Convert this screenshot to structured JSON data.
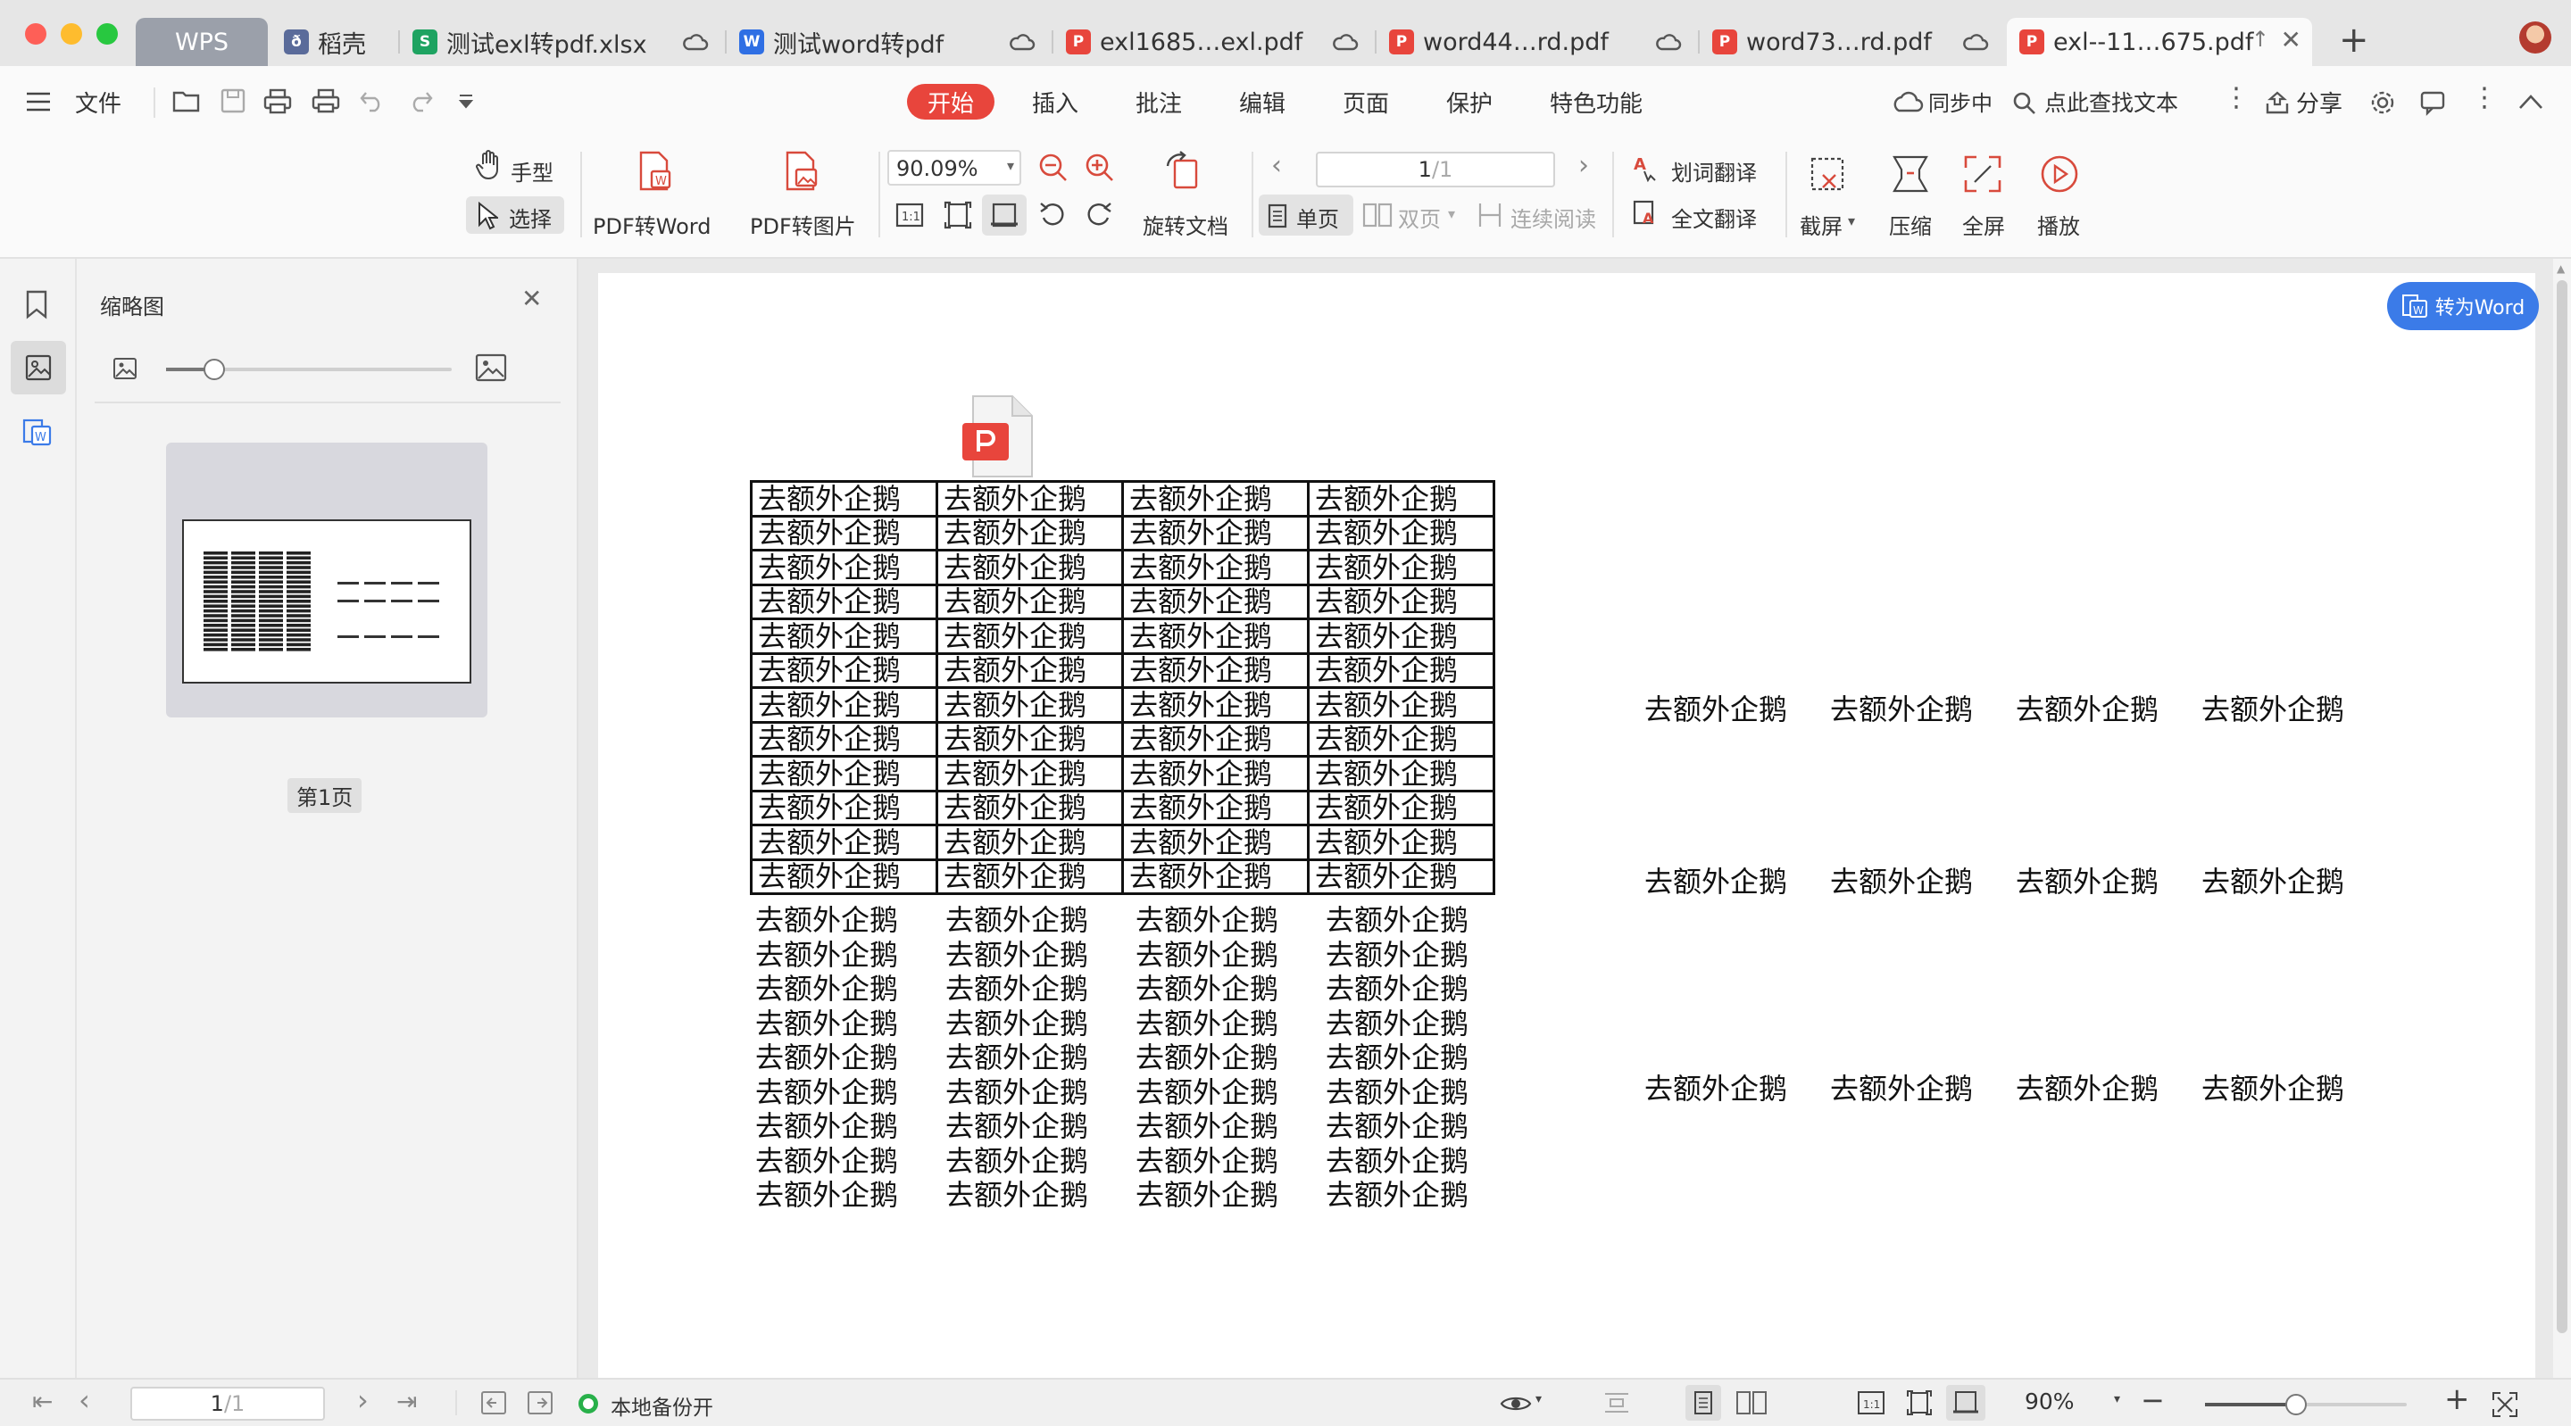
{
  "tabs": {
    "wps": "WPS",
    "items": [
      {
        "label": "稻壳"
      },
      {
        "label": "测试exl转pdf.xlsx"
      },
      {
        "label": "测试word转pdf"
      },
      {
        "label": "exl1685…exl.pdf"
      },
      {
        "label": "word44…rd.pdf"
      },
      {
        "label": "word73…rd.pdf"
      },
      {
        "label": "exl--11…675.pdf"
      }
    ],
    "new_tab": "+"
  },
  "menu": {
    "file": "文件",
    "items": [
      {
        "label": "开始"
      },
      {
        "label": "插入"
      },
      {
        "label": "批注"
      },
      {
        "label": "编辑"
      },
      {
        "label": "页面"
      },
      {
        "label": "保护"
      },
      {
        "label": "特色功能"
      }
    ],
    "sync": "同步中",
    "search": "点此查找文本",
    "share": "分享"
  },
  "toolbar": {
    "hand": "手型",
    "select": "选择",
    "pdf_to_word": "PDF转Word",
    "pdf_to_image": "PDF转图片",
    "zoom": "90.09%",
    "rotate_doc": "旋转文档",
    "page_current": "1",
    "page_total": "/1",
    "single_page": "单页",
    "double_page": "双页",
    "continuous": "连续阅读",
    "word_translate": "划词翻译",
    "full_translate": "全文翻译",
    "screenshot": "截屏",
    "compress": "压缩",
    "fullscreen": "全屏",
    "play": "播放"
  },
  "panel": {
    "title": "缩略图",
    "page_label": "第1页"
  },
  "document": {
    "to_word": "转为Word",
    "cell_text": "去额外企鹅",
    "table_rows": 12,
    "plain_rows": 9,
    "columns": 4,
    "right_rows": [
      [
        "去额外企鹅",
        "去额外企鹅",
        "去额外企鹅",
        "去额外企鹅"
      ],
      [
        "去额外企鹅",
        "去额外企鹅",
        "去额外企鹅",
        "去额外企鹅"
      ],
      [
        "去额外企鹅",
        "去额外企鹅",
        "去额外企鹅",
        "去额外企鹅"
      ]
    ]
  },
  "status": {
    "page_current": "1",
    "page_total": "/1",
    "backup": "本地备份开",
    "zoom": "90%"
  },
  "colors": {
    "accent_red": "#e8453c",
    "blue": "#3b7be8",
    "wps_tab": "#9ba0aa"
  }
}
